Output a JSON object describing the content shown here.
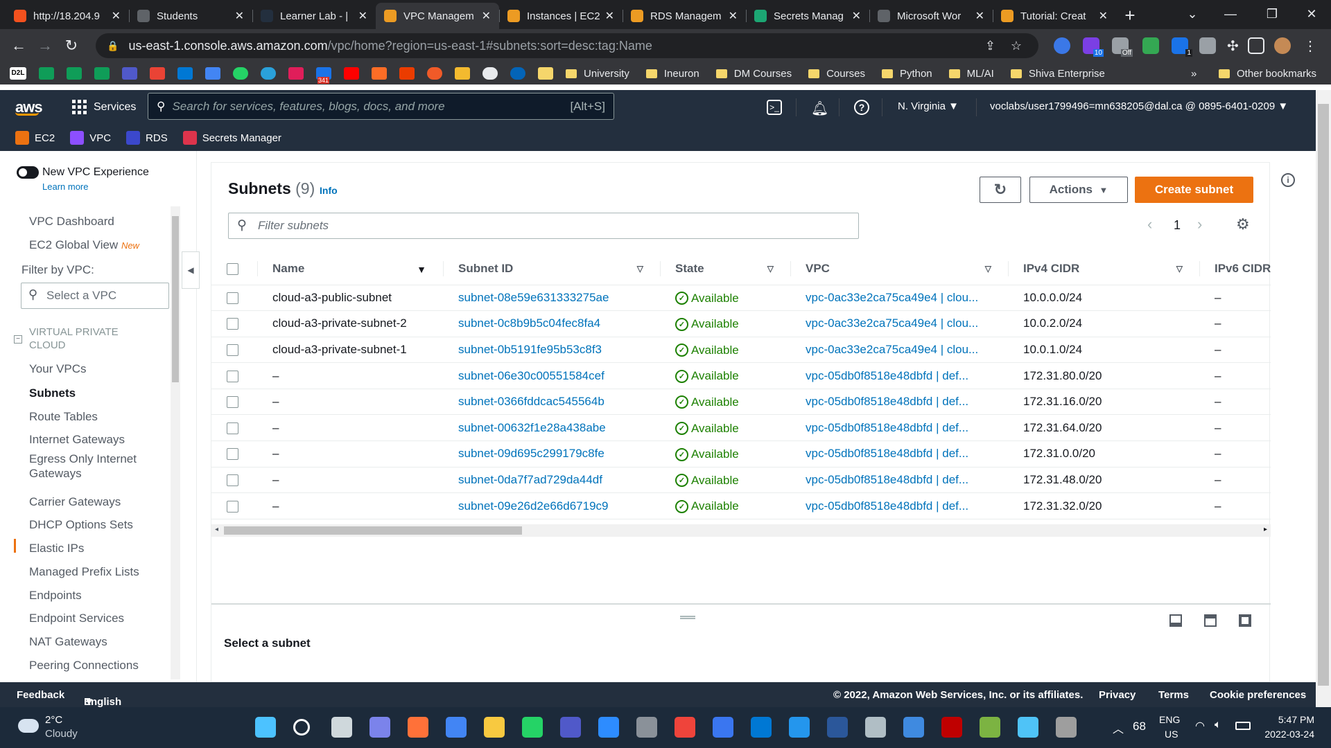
{
  "browser": {
    "tabs": [
      {
        "title": "http://18.204.9",
        "color": "#f4511e"
      },
      {
        "title": "Students",
        "color": "#5f6368"
      },
      {
        "title": "Learner Lab - |",
        "color": "#232f3e"
      },
      {
        "title": "VPC Managem",
        "color": "#ec9b23",
        "active": true
      },
      {
        "title": "Instances | EC2",
        "color": "#ec9b23"
      },
      {
        "title": "RDS Managem",
        "color": "#ec9b23"
      },
      {
        "title": "Secrets Manag",
        "color": "#1ca673"
      },
      {
        "title": "Microsoft Wor",
        "color": "#5f6368"
      },
      {
        "title": "Tutorial: Creat",
        "color": "#ec9b23"
      }
    ],
    "url_host": "us-east-1.console.aws.amazon.com",
    "url_path": "/vpc/home?region=us-east-1#subnets:sort=desc:tag:Name",
    "ext_badges": {
      "a": "10",
      "b": "Off",
      "c": "1"
    },
    "bookmarks": [
      "University",
      "Ineuron",
      "DM Courses",
      "Courses",
      "Python",
      "ML/AI",
      "Shiva Enterprise"
    ],
    "bookmark_badge": "341",
    "other_bookmarks": "Other bookmarks",
    "more": "»"
  },
  "aws": {
    "logo": "aws",
    "services": "Services",
    "search_placeholder": "Search for services, features, blogs, docs, and more",
    "search_shortcut": "[Alt+S]",
    "region": "N. Virginia",
    "account": "voclabs/user1799496=mn638205@dal.ca @ 0895-6401-0209",
    "favorites": [
      "EC2",
      "VPC",
      "RDS",
      "Secrets Manager"
    ]
  },
  "sidebar": {
    "new_experience": "New VPC Experience",
    "learn_more": "Learn more",
    "items_top": [
      "VPC Dashboard",
      "EC2 Global View"
    ],
    "new_badge": "New",
    "filter_label": "Filter by VPC:",
    "vpc_select_placeholder": "Select a VPC",
    "section": "VIRTUAL PRIVATE CLOUD",
    "items": [
      "Your VPCs",
      "Subnets",
      "Route Tables",
      "Internet Gateways",
      "Egress Only Internet Gateways",
      "Carrier Gateways",
      "DHCP Options Sets",
      "Elastic IPs",
      "Managed Prefix Lists",
      "Endpoints",
      "Endpoint Services",
      "NAT Gateways",
      "Peering Connections"
    ]
  },
  "main": {
    "title": "Subnets",
    "count": "(9)",
    "info": "Info",
    "actions": "Actions",
    "create": "Create subnet",
    "filter_placeholder": "Filter subnets",
    "page": "1",
    "columns": [
      "Name",
      "Subnet ID",
      "State",
      "VPC",
      "IPv4 CIDR",
      "IPv6 CIDR"
    ],
    "rows": [
      {
        "name": "cloud-a3-public-subnet",
        "id": "subnet-08e59e631333275ae",
        "state": "Available",
        "vpc": "vpc-0ac33e2ca75ca49e4 | clou...",
        "cidr": "10.0.0.0/24",
        "ipv6": "–"
      },
      {
        "name": "cloud-a3-private-subnet-2",
        "id": "subnet-0c8b9b5c04fec8fa4",
        "state": "Available",
        "vpc": "vpc-0ac33e2ca75ca49e4 | clou...",
        "cidr": "10.0.2.0/24",
        "ipv6": "–"
      },
      {
        "name": "cloud-a3-private-subnet-1",
        "id": "subnet-0b5191fe95b53c8f3",
        "state": "Available",
        "vpc": "vpc-0ac33e2ca75ca49e4 | clou...",
        "cidr": "10.0.1.0/24",
        "ipv6": "–"
      },
      {
        "name": "–",
        "id": "subnet-06e30c00551584cef",
        "state": "Available",
        "vpc": "vpc-05db0f8518e48dbfd | def...",
        "cidr": "172.31.80.0/20",
        "ipv6": "–"
      },
      {
        "name": "–",
        "id": "subnet-0366fddcac545564b",
        "state": "Available",
        "vpc": "vpc-05db0f8518e48dbfd | def...",
        "cidr": "172.31.16.0/20",
        "ipv6": "–"
      },
      {
        "name": "–",
        "id": "subnet-00632f1e28a438abe",
        "state": "Available",
        "vpc": "vpc-05db0f8518e48dbfd | def...",
        "cidr": "172.31.64.0/20",
        "ipv6": "–"
      },
      {
        "name": "–",
        "id": "subnet-09d695c299179c8fe",
        "state": "Available",
        "vpc": "vpc-05db0f8518e48dbfd | def...",
        "cidr": "172.31.0.0/20",
        "ipv6": "–"
      },
      {
        "name": "–",
        "id": "subnet-0da7f7ad729da44df",
        "state": "Available",
        "vpc": "vpc-05db0f8518e48dbfd | def...",
        "cidr": "172.31.48.0/20",
        "ipv6": "–"
      },
      {
        "name": "–",
        "id": "subnet-09e26d2e66d6719c9",
        "state": "Available",
        "vpc": "vpc-05db0f8518e48dbfd | def...",
        "cidr": "172.31.32.0/20",
        "ipv6": "–"
      }
    ],
    "select_subnet": "Select a subnet"
  },
  "footer": {
    "feedback": "Feedback",
    "language": "English (US)",
    "copyright": "© 2022, Amazon Web Services, Inc. or its affiliates.",
    "privacy": "Privacy",
    "terms": "Terms",
    "cookie": "Cookie preferences"
  },
  "taskbar": {
    "temp": "2°C",
    "weather": "Cloudy",
    "battery": "68",
    "lang": "ENG",
    "region": "US",
    "time": "5:47 PM",
    "date": "2022-03-24"
  }
}
